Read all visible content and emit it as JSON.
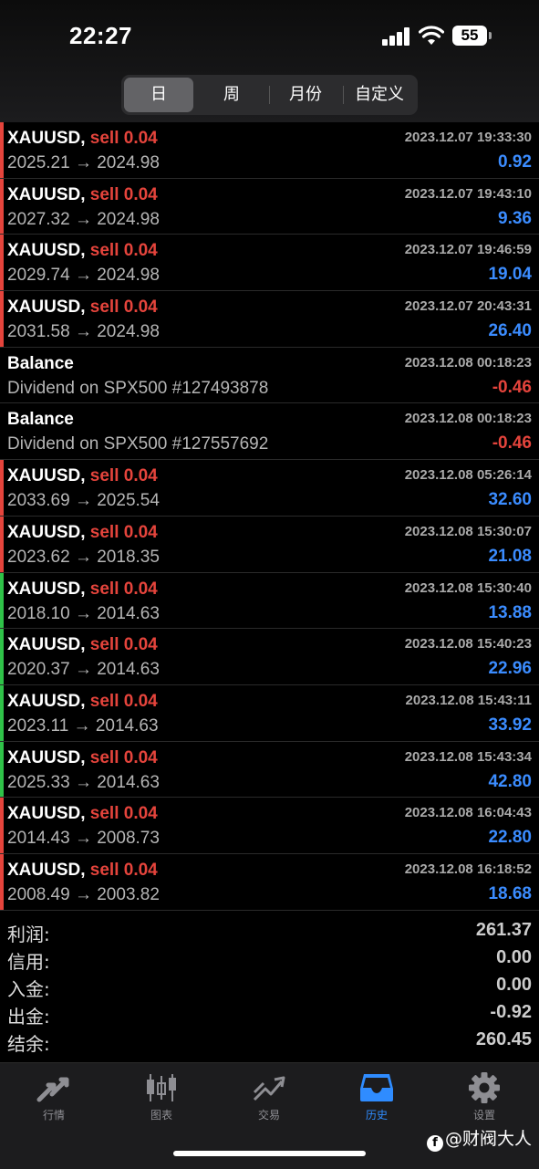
{
  "status_bar": {
    "time": "22:27",
    "battery": "55"
  },
  "period_tabs": [
    {
      "label": "日",
      "active": true
    },
    {
      "label": "周"
    },
    {
      "label": "月份"
    },
    {
      "label": "自定义"
    }
  ],
  "colors": {
    "sell": "#e5443c",
    "profit": "#3b8cff",
    "loss": "#e5443c",
    "bar_red": "#e5443c",
    "bar_green": "#2fc248",
    "active_tab": "#2f8cff"
  },
  "trades": [
    {
      "type": "trade",
      "symbol": "XAUUSD,",
      "side": "sell 0.04",
      "prices": "2025.21 → 2024.98",
      "time": "2023.12.07 19:33:30",
      "pnl": "0.92",
      "bar": "red"
    },
    {
      "type": "trade",
      "symbol": "XAUUSD,",
      "side": "sell 0.04",
      "prices": "2027.32 → 2024.98",
      "time": "2023.12.07 19:43:10",
      "pnl": "9.36",
      "bar": "red"
    },
    {
      "type": "trade",
      "symbol": "XAUUSD,",
      "side": "sell 0.04",
      "prices": "2029.74 → 2024.98",
      "time": "2023.12.07 19:46:59",
      "pnl": "19.04",
      "bar": "red"
    },
    {
      "type": "trade",
      "symbol": "XAUUSD,",
      "side": "sell 0.04",
      "prices": "2031.58 → 2024.98",
      "time": "2023.12.07 20:43:31",
      "pnl": "26.40",
      "bar": "red"
    },
    {
      "type": "balance",
      "symbol": "Balance",
      "side": "",
      "prices": "Dividend on SPX500 #127493878",
      "time": "2023.12.08 00:18:23",
      "pnl": "-0.46",
      "bar": "none"
    },
    {
      "type": "balance",
      "symbol": "Balance",
      "side": "",
      "prices": "Dividend on SPX500 #127557692",
      "time": "2023.12.08 00:18:23",
      "pnl": "-0.46",
      "bar": "none"
    },
    {
      "type": "trade",
      "symbol": "XAUUSD,",
      "side": "sell 0.04",
      "prices": "2033.69 → 2025.54",
      "time": "2023.12.08 05:26:14",
      "pnl": "32.60",
      "bar": "red"
    },
    {
      "type": "trade",
      "symbol": "XAUUSD,",
      "side": "sell 0.04",
      "prices": "2023.62 → 2018.35",
      "time": "2023.12.08 15:30:07",
      "pnl": "21.08",
      "bar": "red"
    },
    {
      "type": "trade",
      "symbol": "XAUUSD,",
      "side": "sell 0.04",
      "prices": "2018.10 → 2014.63",
      "time": "2023.12.08 15:30:40",
      "pnl": "13.88",
      "bar": "green"
    },
    {
      "type": "trade",
      "symbol": "XAUUSD,",
      "side": "sell 0.04",
      "prices": "2020.37 → 2014.63",
      "time": "2023.12.08 15:40:23",
      "pnl": "22.96",
      "bar": "green"
    },
    {
      "type": "trade",
      "symbol": "XAUUSD,",
      "side": "sell 0.04",
      "prices": "2023.11 → 2014.63",
      "time": "2023.12.08 15:43:11",
      "pnl": "33.92",
      "bar": "green"
    },
    {
      "type": "trade",
      "symbol": "XAUUSD,",
      "side": "sell 0.04",
      "prices": "2025.33 → 2014.63",
      "time": "2023.12.08 15:43:34",
      "pnl": "42.80",
      "bar": "green"
    },
    {
      "type": "trade",
      "symbol": "XAUUSD,",
      "side": "sell 0.04",
      "prices": "2014.43 → 2008.73",
      "time": "2023.12.08 16:04:43",
      "pnl": "22.80",
      "bar": "red"
    },
    {
      "type": "trade",
      "symbol": "XAUUSD,",
      "side": "sell 0.04",
      "prices": "2008.49 → 2003.82",
      "time": "2023.12.08 16:18:52",
      "pnl": "18.68",
      "bar": "red"
    }
  ],
  "summary": [
    {
      "label": "利润:",
      "value": "261.37"
    },
    {
      "label": "信用:",
      "value": "0.00"
    },
    {
      "label": "入金:",
      "value": "0.00"
    },
    {
      "label": "出金:",
      "value": "-0.92"
    },
    {
      "label": "结余:",
      "value": "260.45"
    }
  ],
  "tab_bar": [
    {
      "label": "行情",
      "icon": "quotes-arrows-icon"
    },
    {
      "label": "图表",
      "icon": "candlestick-chart-icon"
    },
    {
      "label": "交易",
      "icon": "trade-trend-icon"
    },
    {
      "label": "历史",
      "icon": "history-inbox-icon",
      "active": true
    },
    {
      "label": "设置",
      "icon": "gear-icon"
    }
  ],
  "watermark": "@财阀大人"
}
